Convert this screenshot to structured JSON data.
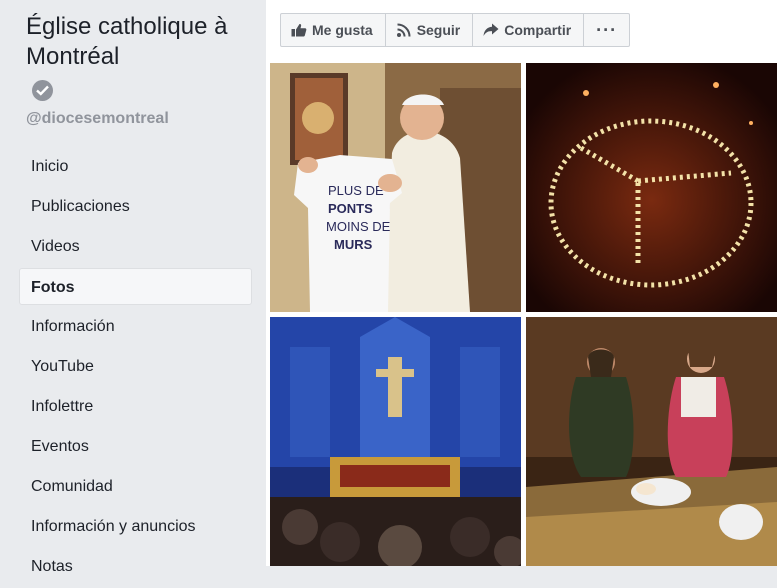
{
  "sidebar": {
    "page_name": "Église catholique à Montréal",
    "handle": "@diocesemontreal",
    "verified": true,
    "items": [
      {
        "label": "Inicio",
        "active": false
      },
      {
        "label": "Publicaciones",
        "active": false
      },
      {
        "label": "Videos",
        "active": false
      },
      {
        "label": "Fotos",
        "active": true
      },
      {
        "label": "Información",
        "active": false
      },
      {
        "label": "YouTube",
        "active": false
      },
      {
        "label": "Infolettre",
        "active": false
      },
      {
        "label": "Eventos",
        "active": false
      },
      {
        "label": "Comunidad",
        "active": false
      },
      {
        "label": "Información y anuncios",
        "active": false
      },
      {
        "label": "Notas",
        "active": false
      }
    ]
  },
  "actions": {
    "like": {
      "label": "Me gusta",
      "icon": "thumbs-up-icon"
    },
    "follow": {
      "label": "Seguir",
      "icon": "rss-icon"
    },
    "share": {
      "label": "Compartir",
      "icon": "share-arrow-icon"
    },
    "more": {
      "label": "···",
      "icon": "more-icon"
    }
  },
  "photos": {
    "photo1": {
      "shirt_text": [
        "PLUS DE",
        "PONTS",
        "MOINS DE",
        "MURS"
      ]
    },
    "photo2": {
      "subject": "candles in peace symbol"
    },
    "photo3": {
      "subject": "cathedral interior"
    },
    "photo4": {
      "subject": "nativity scene"
    }
  },
  "colors": {
    "sidebar_bg": "#e9ebee",
    "text": "#1d2129",
    "muted": "#90949c",
    "button_text": "#4b4f56"
  }
}
